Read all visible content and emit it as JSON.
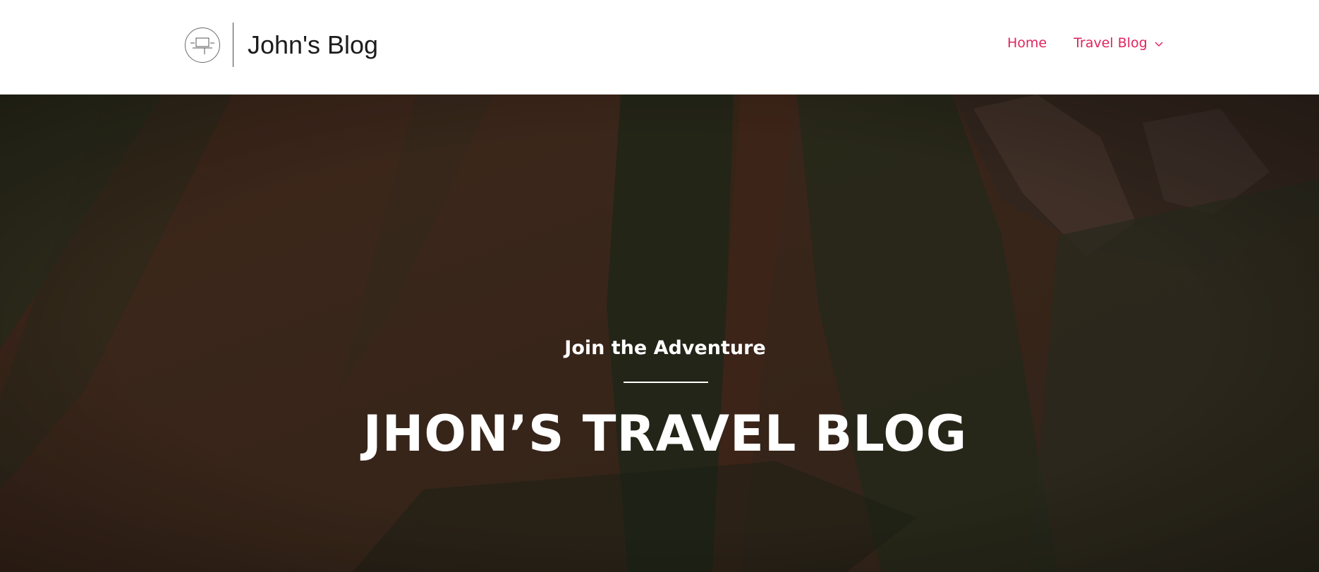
{
  "header": {
    "site_title": "John's Blog",
    "logo_icon": "laptop-icon"
  },
  "nav": {
    "items": [
      {
        "label": "Home"
      },
      {
        "label": "Travel Blog",
        "has_dropdown": true,
        "dropdown_icon": "chevron-down-icon"
      }
    ],
    "accent_color": "#e0245e"
  },
  "hero": {
    "tagline": "Join the Adventure",
    "title": "JHON’S TRAVEL BLOG",
    "background": "mountain-slope-photo"
  }
}
